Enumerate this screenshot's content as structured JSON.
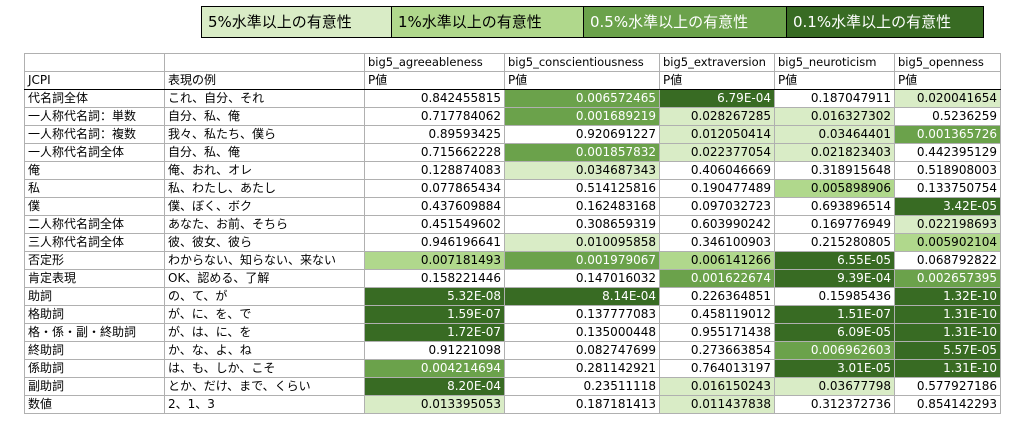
{
  "legend": [
    {
      "label": "5%水準以上の有意性",
      "level": 1
    },
    {
      "label": "1%水準以上の有意性",
      "level": 2
    },
    {
      "label": "0.5%水準以上の有意性",
      "level": 3
    },
    {
      "label": "0.1%水準以上の有意性",
      "level": 4
    }
  ],
  "colors": {
    "level1": "#d9ecc6",
    "level2": "#b0d88c",
    "level3": "#6ba24b",
    "level4": "#386b23"
  },
  "table": {
    "col_jcpi": "JCPI",
    "col_example": "表現の例",
    "traits": [
      "big5_agreeableness",
      "big5_conscientiousness",
      "big5_extraversion",
      "big5_neuroticism",
      "big5_openness"
    ],
    "pvalue_label": "P値",
    "rows": [
      {
        "name": "代名詞全体",
        "example": "これ、自分、それ",
        "values": [
          "0.842455815",
          "0.006572465",
          "6.79E-04",
          "0.187047911",
          "0.020041654"
        ],
        "levels": [
          0,
          3,
          4,
          0,
          1
        ]
      },
      {
        "name": "一人称代名詞：単数",
        "example": "自分、私、俺",
        "values": [
          "0.717784062",
          "0.001689219",
          "0.028267285",
          "0.016327302",
          "0.5236259"
        ],
        "levels": [
          0,
          3,
          1,
          1,
          0
        ]
      },
      {
        "name": "一人称代名詞：複数",
        "example": "我々、私たち、僕ら",
        "values": [
          "0.89593425",
          "0.920691227",
          "0.012050414",
          "0.03464401",
          "0.001365726"
        ],
        "levels": [
          0,
          0,
          1,
          1,
          3
        ]
      },
      {
        "name": "一人称代名詞全体",
        "example": "自分、私、俺",
        "values": [
          "0.715662228",
          "0.001857832",
          "0.022377054",
          "0.021823403",
          "0.442395129"
        ],
        "levels": [
          0,
          3,
          1,
          1,
          0
        ]
      },
      {
        "name": "俺",
        "example": "俺、おれ、オレ",
        "values": [
          "0.128874083",
          "0.034687343",
          "0.406046669",
          "0.318915648",
          "0.518908003"
        ],
        "levels": [
          0,
          1,
          0,
          0,
          0
        ]
      },
      {
        "name": "私",
        "example": "私、わたし、あたし",
        "values": [
          "0.077865434",
          "0.514125816",
          "0.190477489",
          "0.005898906",
          "0.133750754"
        ],
        "levels": [
          0,
          0,
          0,
          2,
          0
        ]
      },
      {
        "name": "僕",
        "example": "僕、ぼく、ボク",
        "values": [
          "0.437609884",
          "0.162483168",
          "0.097032723",
          "0.693896514",
          "3.42E-05"
        ],
        "levels": [
          0,
          0,
          0,
          0,
          4
        ]
      },
      {
        "name": "二人称代名詞全体",
        "example": "あなた、お前、そちら",
        "values": [
          "0.451549602",
          "0.308659319",
          "0.603990242",
          "0.169776949",
          "0.022198693"
        ],
        "levels": [
          0,
          0,
          0,
          0,
          1
        ]
      },
      {
        "name": "三人称代名詞全体",
        "example": "彼、彼女、彼ら",
        "values": [
          "0.946196641",
          "0.010095858",
          "0.346100903",
          "0.215280805",
          "0.005902104"
        ],
        "levels": [
          0,
          1,
          0,
          0,
          2
        ]
      },
      {
        "name": "否定形",
        "example": "わからない、知らない、来ない",
        "values": [
          "0.007181493",
          "0.001979067",
          "0.006141266",
          "6.55E-05",
          "0.068792822"
        ],
        "levels": [
          2,
          3,
          2,
          4,
          0
        ]
      },
      {
        "name": "肯定表現",
        "example": "OK、認める、了解",
        "values": [
          "0.158221446",
          "0.147016032",
          "0.001622674",
          "9.39E-04",
          "0.002657395"
        ],
        "levels": [
          0,
          0,
          3,
          4,
          3
        ]
      },
      {
        "name": "助詞",
        "example": "の、て、が",
        "values": [
          "5.32E-08",
          "8.14E-04",
          "0.226364851",
          "0.15985436",
          "1.32E-10"
        ],
        "levels": [
          4,
          4,
          0,
          0,
          4
        ]
      },
      {
        "name": "格助詞",
        "example": "が、に、を、で",
        "values": [
          "1.59E-07",
          "0.137777083",
          "0.458119012",
          "1.51E-07",
          "1.31E-10"
        ],
        "levels": [
          4,
          0,
          0,
          4,
          4
        ]
      },
      {
        "name": "格・係・副・終助詞",
        "example": "が、は、に、を",
        "values": [
          "1.72E-07",
          "0.135000448",
          "0.955171438",
          "6.09E-05",
          "1.31E-10"
        ],
        "levels": [
          4,
          0,
          0,
          4,
          4
        ]
      },
      {
        "name": "終助詞",
        "example": "か、な、よ、ね",
        "values": [
          "0.91221098",
          "0.082747699",
          "0.273663854",
          "0.006962603",
          "5.57E-05"
        ],
        "levels": [
          0,
          0,
          0,
          3,
          4
        ]
      },
      {
        "name": "係助詞",
        "example": "は、も、しか、こそ",
        "values": [
          "0.004214694",
          "0.281142921",
          "0.764013197",
          "3.01E-05",
          "1.31E-10"
        ],
        "levels": [
          3,
          0,
          0,
          4,
          4
        ]
      },
      {
        "name": "副助詞",
        "example": "とか、だけ、まで、くらい",
        "values": [
          "8.20E-04",
          "0.23511118",
          "0.016150243",
          "0.03677798",
          "0.577927186"
        ],
        "levels": [
          4,
          0,
          1,
          1,
          0
        ]
      },
      {
        "name": "数値",
        "example": "2、1、3",
        "values": [
          "0.013395053",
          "0.187181413",
          "0.011437838",
          "0.312372736",
          "0.854142293"
        ],
        "levels": [
          1,
          0,
          1,
          0,
          0
        ]
      }
    ]
  }
}
